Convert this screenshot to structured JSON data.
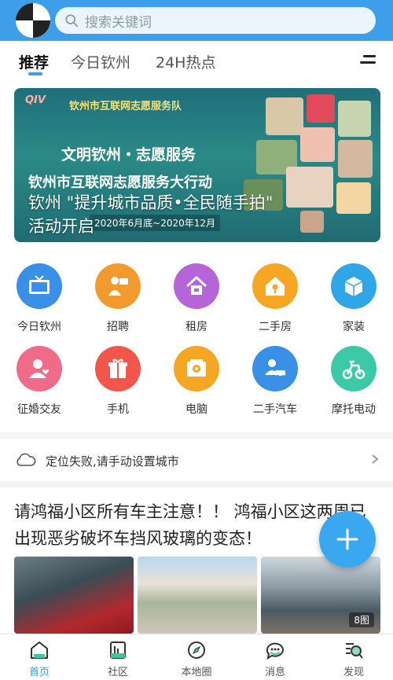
{
  "header": {
    "search_placeholder": "搜索关键词",
    "accent_color": "#3d9fea"
  },
  "tabs": [
    {
      "label": "推荐",
      "active": true
    },
    {
      "label": "今日钦州",
      "active": false
    },
    {
      "label": "24H热点",
      "active": false
    }
  ],
  "banner": {
    "logo_text": "QIV",
    "org_name": "钦州市互联网志愿服务队",
    "headline": "文明钦州・志愿服务",
    "subheadline": "钦州市互联网志愿服务大行动",
    "date_range": "2020年6月底~2020年12月",
    "caption_line1": "钦州 \"提升城市品质•全民随手拍\"",
    "caption_line2": "活动开启"
  },
  "categories": [
    {
      "label": "今日钦州",
      "icon": "news-tv-icon",
      "color": "#3a8fe6"
    },
    {
      "label": "招聘",
      "icon": "recruit-icon",
      "color": "#f29a2e"
    },
    {
      "label": "租房",
      "icon": "rent-house-icon",
      "color": "#b665d8"
    },
    {
      "label": "二手房",
      "icon": "house-icon",
      "color": "#f5a623"
    },
    {
      "label": "家装",
      "icon": "box-icon",
      "color": "#2fa7e6"
    },
    {
      "label": "征婚交友",
      "icon": "dating-icon",
      "color": "#f06a8a"
    },
    {
      "label": "手机",
      "icon": "phone-gift-icon",
      "color": "#f2564a"
    },
    {
      "label": "电脑",
      "icon": "computer-icon",
      "color": "#f5a623"
    },
    {
      "label": "二手汽车",
      "icon": "car-icon",
      "color": "#3a8fe6"
    },
    {
      "label": "摩托电动",
      "icon": "bike-icon",
      "color": "#3cc9a8"
    }
  ],
  "location": {
    "text": "定位失败,请手动设置城市"
  },
  "article": {
    "title": "请鸿福小区所有车主注意！！ 鸿福小区这两周已出现恶劣破坏车挡风玻璃的变态！",
    "image_count": "8图"
  },
  "bottom_nav": [
    {
      "label": "首页",
      "icon": "home-icon",
      "active": true
    },
    {
      "label": "社区",
      "icon": "community-icon",
      "active": false
    },
    {
      "label": "本地圈",
      "icon": "compass-icon",
      "active": false
    },
    {
      "label": "消息",
      "icon": "message-icon",
      "active": false
    },
    {
      "label": "发现",
      "icon": "discover-icon",
      "active": false
    }
  ]
}
